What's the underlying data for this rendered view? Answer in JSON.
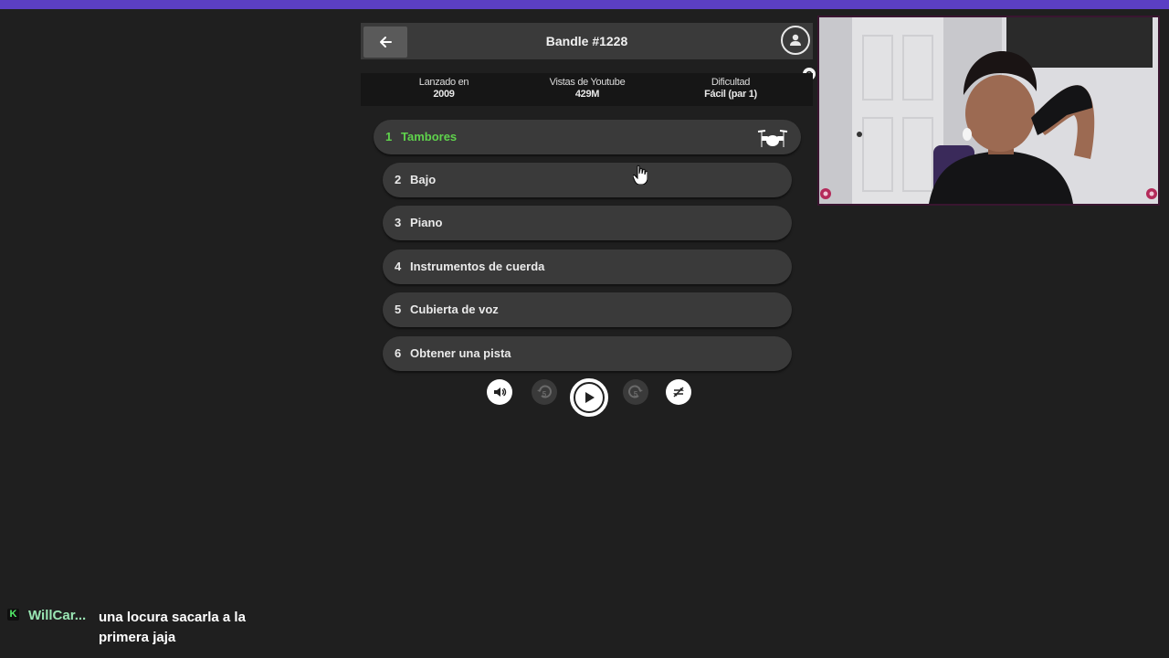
{
  "colors": {
    "accent": "#5fd24c",
    "top_bar": "#5b3fc4",
    "background": "#1f1f1f",
    "header": "#3a3a3a",
    "track": "#3a3a3a"
  },
  "header": {
    "title": "Bandle #1228",
    "back_icon": "arrow-left-icon",
    "profile_icon": "user-icon"
  },
  "stats": [
    {
      "label": "Lanzado en",
      "value": "2009"
    },
    {
      "label": "Vistas de Youtube",
      "value": "429M"
    },
    {
      "label": "Dificultad",
      "value": "Fácil (par 1)"
    }
  ],
  "tracks": [
    {
      "num": "1",
      "name": "Tambores",
      "active": true,
      "icon": "drum-kit-icon"
    },
    {
      "num": "2",
      "name": "Bajo"
    },
    {
      "num": "3",
      "name": "Piano"
    },
    {
      "num": "4",
      "name": "Instrumentos de cuerda"
    },
    {
      "num": "5",
      "name": "Cubierta de voz"
    },
    {
      "num": "6",
      "name": "Obtener una pista"
    }
  ],
  "controls": [
    "volume-icon",
    "rewind-5-icon",
    "play-icon",
    "forward-5-icon",
    "repeat-icon"
  ],
  "chat": {
    "badge": "K",
    "user": "WillCar...",
    "message": "una locura sacarla a la primera jaja"
  }
}
